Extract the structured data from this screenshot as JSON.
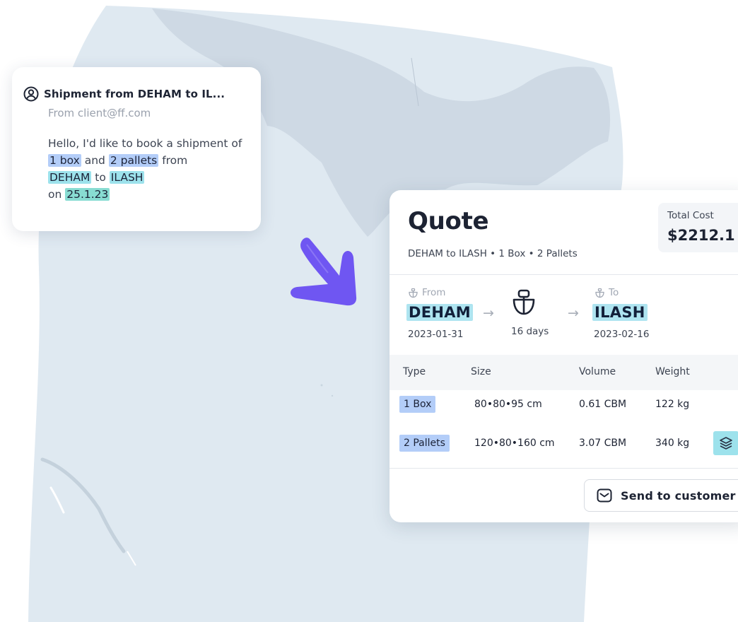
{
  "email": {
    "subject": "Shipment from DEHAM to IL...",
    "from": "From client@ff.com",
    "body": {
      "t1": "Hello, I'd like to book a shipment of ",
      "h1": "1 box",
      "t2": " and ",
      "h2": "2 pallets",
      "t3": " from ",
      "h3": "DEHAM",
      "t4": " to ",
      "h4": "ILASH",
      "t5": " on ",
      "h5": "25.1.23"
    }
  },
  "quote": {
    "title": "Quote",
    "subtitle": "DEHAM to ILASH • 1 Box • 2 Pallets",
    "total_cost_label": "Total Cost",
    "total_cost_value": "$2212.1",
    "route": {
      "from_label": "From",
      "from_code": "DEHAM",
      "from_date": "2023-01-31",
      "to_label": "To",
      "to_code": "ILASH",
      "to_date": "2023-02-16",
      "duration": "16 days",
      "arrow": "→"
    },
    "table": {
      "headers": [
        "Type",
        "Size",
        "Volume",
        "Weight"
      ],
      "rows": [
        {
          "type": "1 Box",
          "size": "80•80•95 cm",
          "volume": "0.61 CBM",
          "weight": "122 kg"
        },
        {
          "type": "2 Pallets",
          "size": "120•80•160 cm",
          "volume": "3.07 CBM",
          "weight": "340 kg"
        }
      ]
    },
    "send_button": "Send to customer"
  },
  "icons": {
    "email_sender": "user-circle-icon",
    "ship": "ship-icon",
    "stack": "layers-icon",
    "envelope": "envelope-icon"
  },
  "colors": {
    "highlight_blue": "#b3cdf8",
    "highlight_cyan": "#9de2ec",
    "highlight_teal": "#88dcd2",
    "arrow_accent": "#6f56f2",
    "map_water": "#dfe9f1"
  }
}
